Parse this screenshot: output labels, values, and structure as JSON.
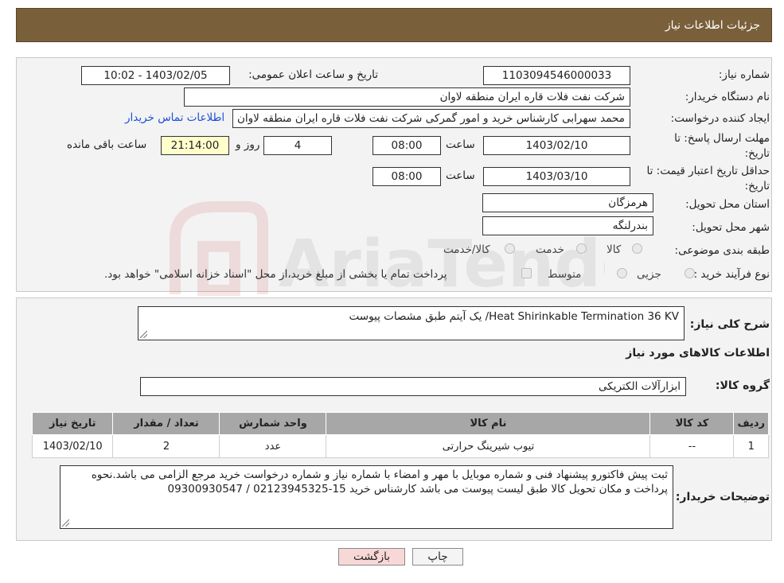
{
  "header": {
    "title": "جزئیات اطلاعات نیاز"
  },
  "watermark": {
    "text": "AriaTender.neT"
  },
  "form": {
    "need_number_label": "شماره نیاز:",
    "need_number": "1103094546000033",
    "announce_label": "تاریخ و ساعت اعلان عمومی:",
    "announce_value": "1403/02/05 - 10:02",
    "buyer_org_label": "نام دستگاه خریدار:",
    "buyer_org": "شرکت نفت فلات قاره ایران منطقه لاوان",
    "requester_label": "ایجاد کننده درخواست:",
    "requester": "محمد سهرابی کارشناس خرید و امور گمرکی شرکت نفت فلات قاره ایران منطقه لاوان",
    "contact_link": "اطلاعات تماس خریدار",
    "reply_deadline_label": "مهلت ارسال پاسخ: تا تاریخ:",
    "reply_date": "1403/02/10",
    "time_label": "ساعت",
    "reply_time": "08:00",
    "days_value": "4",
    "days_label": "روز و",
    "remaining_time": "21:14:00",
    "remaining_label": "ساعت باقی مانده",
    "price_validity_label": "حداقل تاریخ اعتبار قیمت: تا تاریخ:",
    "price_date": "1403/03/10",
    "price_time": "08:00",
    "province_label": "استان محل تحویل:",
    "province": "هرمزگان",
    "city_label": "شهر محل تحویل:",
    "city": "بندرلنگه",
    "category_label": "طبقه بندی موضوعی:",
    "category_options": [
      "کالا",
      "خدمت",
      "کالا/خدمت"
    ],
    "purchase_type_label": "نوع فرآیند خرید :",
    "purchase_options": [
      "جزیی",
      "متوسط"
    ],
    "purchase_note": "پرداخت تمام یا بخشی از مبلغ خرید،از محل \"اسناد خزانه اسلامی\" خواهد بود."
  },
  "summary": {
    "label": "شرح کلی نیاز:",
    "value": "Heat Shirinkable Termination 36 KV/ یک آیتم طبق مشصات پیوست",
    "goods_info_title": "اطلاعات کالاهای مورد نیاز",
    "group_label": "گروه کالا:",
    "group_value": "ابزارآلات الکتریکی"
  },
  "table": {
    "headers": [
      "ردیف",
      "کد کالا",
      "نام کالا",
      "واحد شمارش",
      "تعداد / مقدار",
      "تاریخ نیاز"
    ],
    "rows": [
      [
        "1",
        "--",
        "تیوب شیرینگ حرارتی",
        "عدد",
        "2",
        "1403/02/10"
      ]
    ]
  },
  "buyer_notes": {
    "label": "توضیحات خریدار:",
    "value": "ثبت پیش فاکتورو پیشنهاد فنی و شماره موبایل با مهر و امضاء با شماره نیاز و شماره درخواست خرید مرجع الزامی می باشد.نحوه پرداخت و مکان تحویل کالا طبق لیست پیوست می باشد کارشناس خرید 15-02123945325 / 09300930547"
  },
  "buttons": {
    "print": "چاپ",
    "back": "بازگشت"
  },
  "colors": {
    "header": "#7a5f3b",
    "back_button": "#f8d7d7",
    "print_button": "#f4f4f4",
    "remaining_bg": "#ffffcc"
  }
}
